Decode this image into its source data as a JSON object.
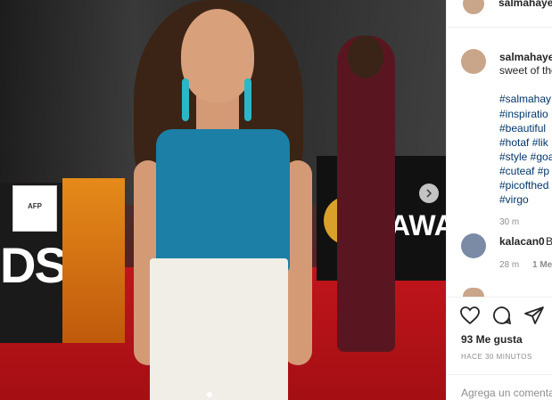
{
  "header": {
    "username": "salmahayek"
  },
  "post": {
    "author": "salmahaye",
    "caption": "sweet of the",
    "hashtags": [
      "#salmahay",
      "#inspiratio",
      "#beautiful",
      "#hotaf #lik",
      "#style #goa",
      "#cuteaf #p",
      "#picofthed",
      "#virgo"
    ],
    "caption_time": "30 m"
  },
  "comments": [
    {
      "user": "kalacan0",
      "text": "B",
      "time": "28 m",
      "likes": "1 Me"
    }
  ],
  "stats": {
    "likes": "93 Me gusta",
    "timestamp": "HACE 30 MINUTOS"
  },
  "input": {
    "placeholder": "Agrega un comentario"
  },
  "photo": {
    "sign_text": "AFP",
    "banner_left_text": "DS",
    "banner_right_text": "AWA"
  },
  "icons": {
    "like": "heart-icon",
    "comment": "comment-bubble-icon",
    "share": "paper-plane-icon",
    "next": "chevron-right-icon"
  },
  "colors": {
    "hashtag": "#00376b",
    "meta": "#8e8e8e",
    "text": "#262626"
  }
}
